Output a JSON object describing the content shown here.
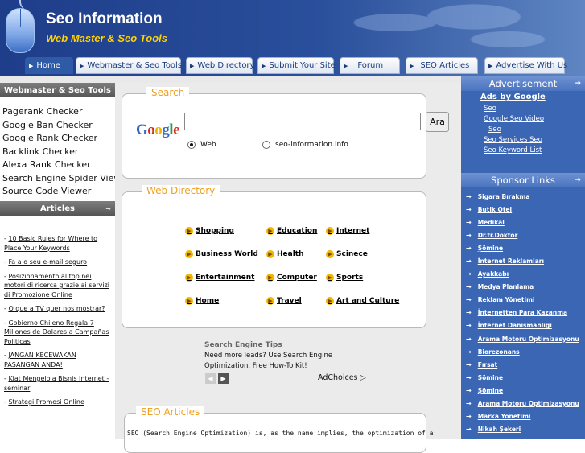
{
  "header": {
    "title": "Seo Information",
    "subtitle": "Web Master & Seo Tools"
  },
  "nav": [
    "Home",
    "Webmaster & Seo Tools",
    "Web Directory",
    "Submit Your Site",
    "Forum",
    "SEO Articles",
    "Advertise With Us"
  ],
  "left": {
    "tools_heading": "Webmaster & Seo Tools",
    "tools": [
      "Pagerank Checker",
      "Google Ban Checker",
      "Google Rank Checker",
      "Backlink Checker",
      "Alexa Rank Checker",
      "Search Engine Spider View",
      "Source Code Viewer"
    ],
    "articles_heading": "Articles",
    "articles": [
      "10 Basic Rules for Where to Place Your Keywords",
      "Fa a o seu e-mail seguro",
      "Posizionamento al top nei motori di ricerca grazie ai servizi di Promozione Online",
      "O que a TV quer nos mostrar?",
      "Gobierno Chileno Regala 7 Millones de Dolares a Campañas Politicas",
      "JANGAN KECEWAKAN PASANGAN ANDA!",
      "Kiat Mengelola Bisnis Internet - seminar",
      "Strategi Promosi Online"
    ]
  },
  "search": {
    "label": "Search",
    "logo": "Google",
    "button": "Ara",
    "options": [
      "Web",
      "seo-information.info"
    ]
  },
  "directory": {
    "label": "Web Directory",
    "categories": [
      "Shopping",
      "Education",
      "Internet",
      "Business World",
      "Health",
      "Scinece",
      "Entertainment",
      "Computer",
      "Sports",
      "Home",
      "Travel",
      "Art and Culture"
    ]
  },
  "tips": {
    "title": "Search Engine Tips",
    "body": "Need more leads? Use Search Engine Optimization. Free How-To Kit!",
    "adchoices": "AdChoices"
  },
  "seo_articles": {
    "label": "SEO Articles",
    "text": "SEO (Search Engine Optimization) is, as the name implies, the optimization of a"
  },
  "right": {
    "ad_heading": "Advertisement",
    "ads_by": "Ads by Google",
    "ad_links": [
      "Seo",
      "Google Seo Video",
      "Seo",
      "Seo Services Seo",
      "Seo Keyword List"
    ],
    "sponsor_heading": "Sponsor Links",
    "sponsors": [
      "Sigara Bırakma",
      "Butik Otel",
      "Medikal",
      "Dr.tr.Doktor",
      "Şömine",
      "İnternet Reklamları",
      "Ayakkabı",
      "Medya Planlama",
      "Reklam Yönetimi",
      "İnternetten Para Kazanma",
      "İnternet Danışmanlığı",
      "Arama Motoru Optimizasyonu",
      "Biorezonans",
      "Fırsat",
      "Şömine",
      "Şömine",
      "Arama Motoru Optimizasyonu",
      "Marka Yönetimi",
      "Nikah Şekeri"
    ]
  },
  "colors": {
    "header": "#1e3d8a",
    "accent": "#ffd200",
    "label": "#f0a020",
    "right": "#3a66b4"
  }
}
